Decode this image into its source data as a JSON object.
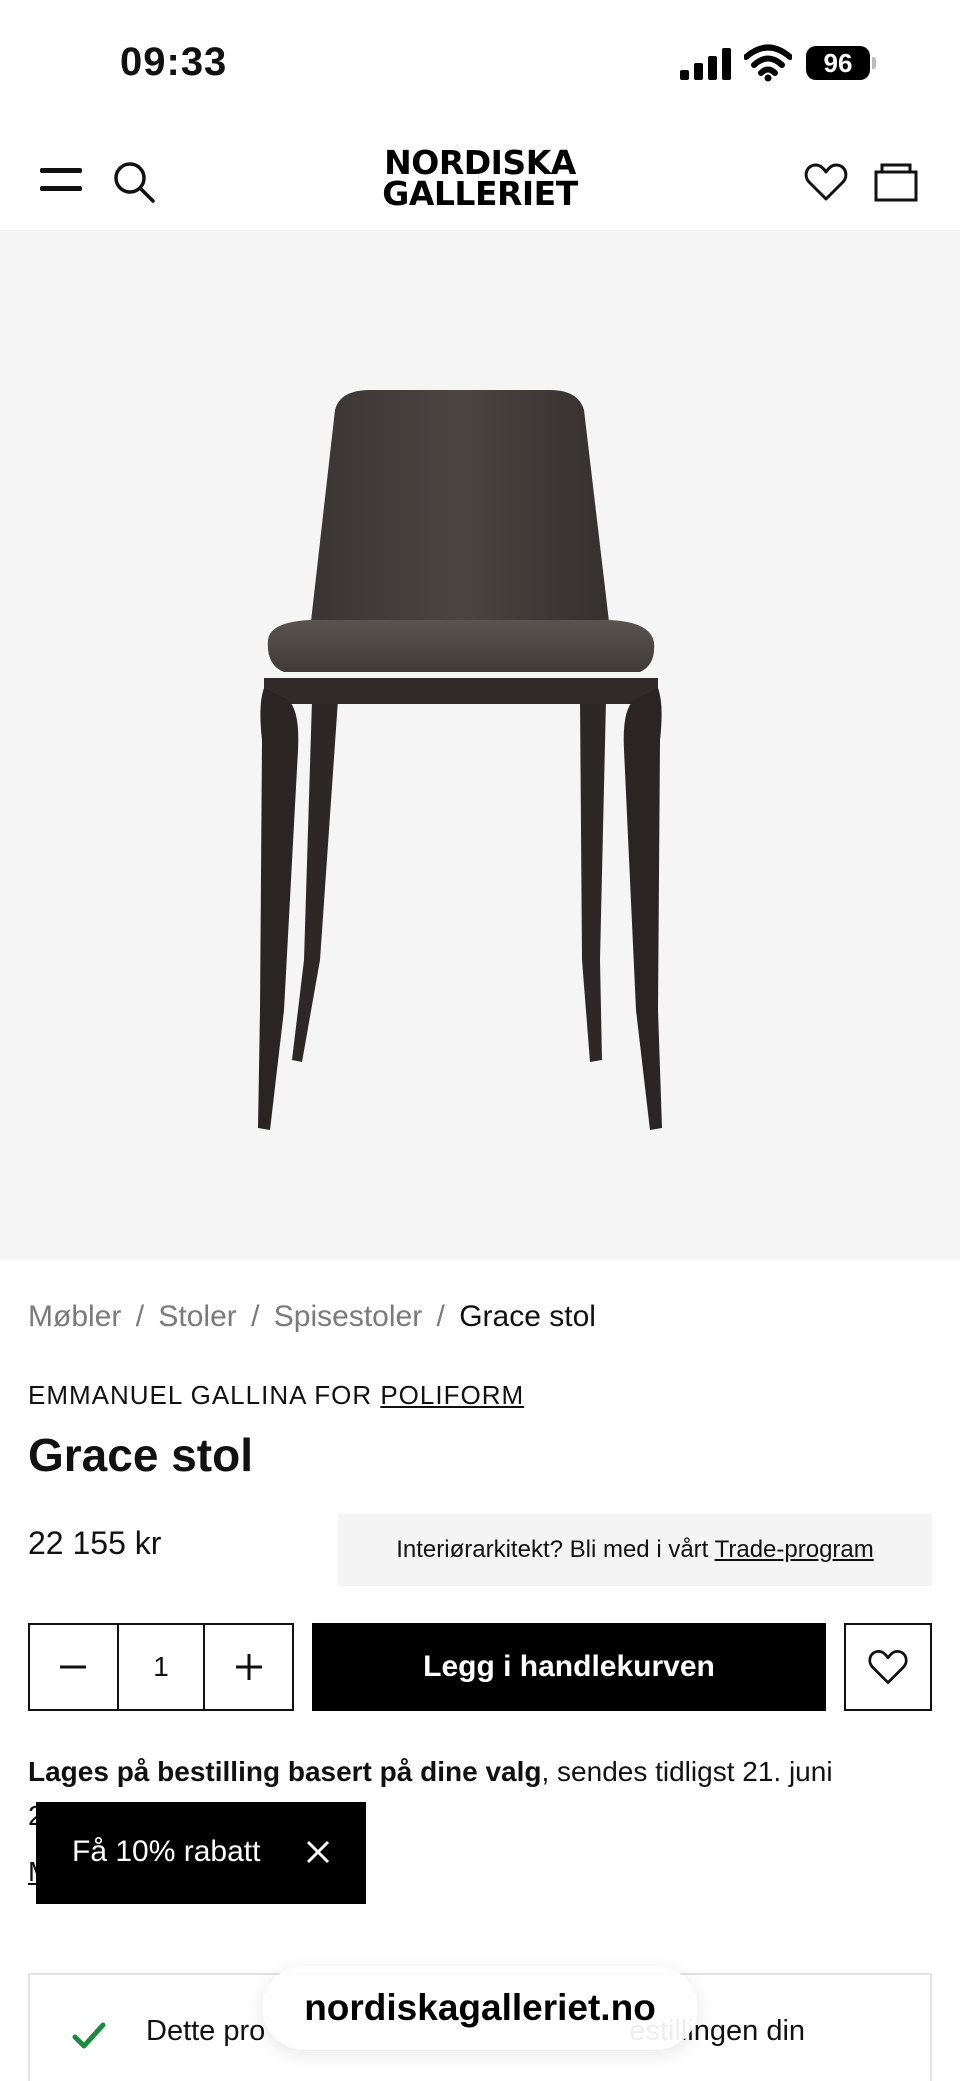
{
  "status_bar": {
    "time": "09:33",
    "battery": "96",
    "icons": [
      "signal-icon",
      "wifi-icon",
      "battery-icon"
    ]
  },
  "header": {
    "logo_line1": "NORDISKA",
    "logo_line2": "GALLERIET",
    "icons": [
      "menu-icon",
      "search-icon",
      "heart-icon",
      "cart-icon"
    ]
  },
  "product_image": {
    "subject": "chair-image"
  },
  "breadcrumb": {
    "items": [
      "Møbler",
      "Stoler",
      "Spisestoler"
    ],
    "separator": "/",
    "current": "Grace stol"
  },
  "product": {
    "designer_prefix": "EMMANUEL GALLINA FOR ",
    "brand": "POLIFORM",
    "title": "Grace stol",
    "price": "22 155 kr"
  },
  "trade": {
    "text": "Interiørarkitekt? Bli med i vårt ",
    "link": "Trade-program"
  },
  "buy": {
    "quantity": "1",
    "add_to_cart": "Legg i handlekurven",
    "icons": [
      "minus-icon",
      "plus-icon",
      "heart-icon"
    ]
  },
  "shipping": {
    "bold": "Lages på bestilling basert på dine valg",
    "rest": ", sendes tidligst 21. juni",
    "line2_start": "2",
    "more_start": "M"
  },
  "discount_popup": {
    "label": "Få 10% rabatt",
    "icon": "close-icon"
  },
  "info": {
    "text_start": "Dette pro",
    "text_end": "estillingen din",
    "icon": "check-icon",
    "icon_color": "#1a8a3c"
  },
  "url_bar": {
    "domain": "nordiskagalleriet.no"
  },
  "colors": {
    "image_bg": "#f5f5f5",
    "primary_button": "#000000",
    "trade_bg": "#f4f4f4"
  }
}
